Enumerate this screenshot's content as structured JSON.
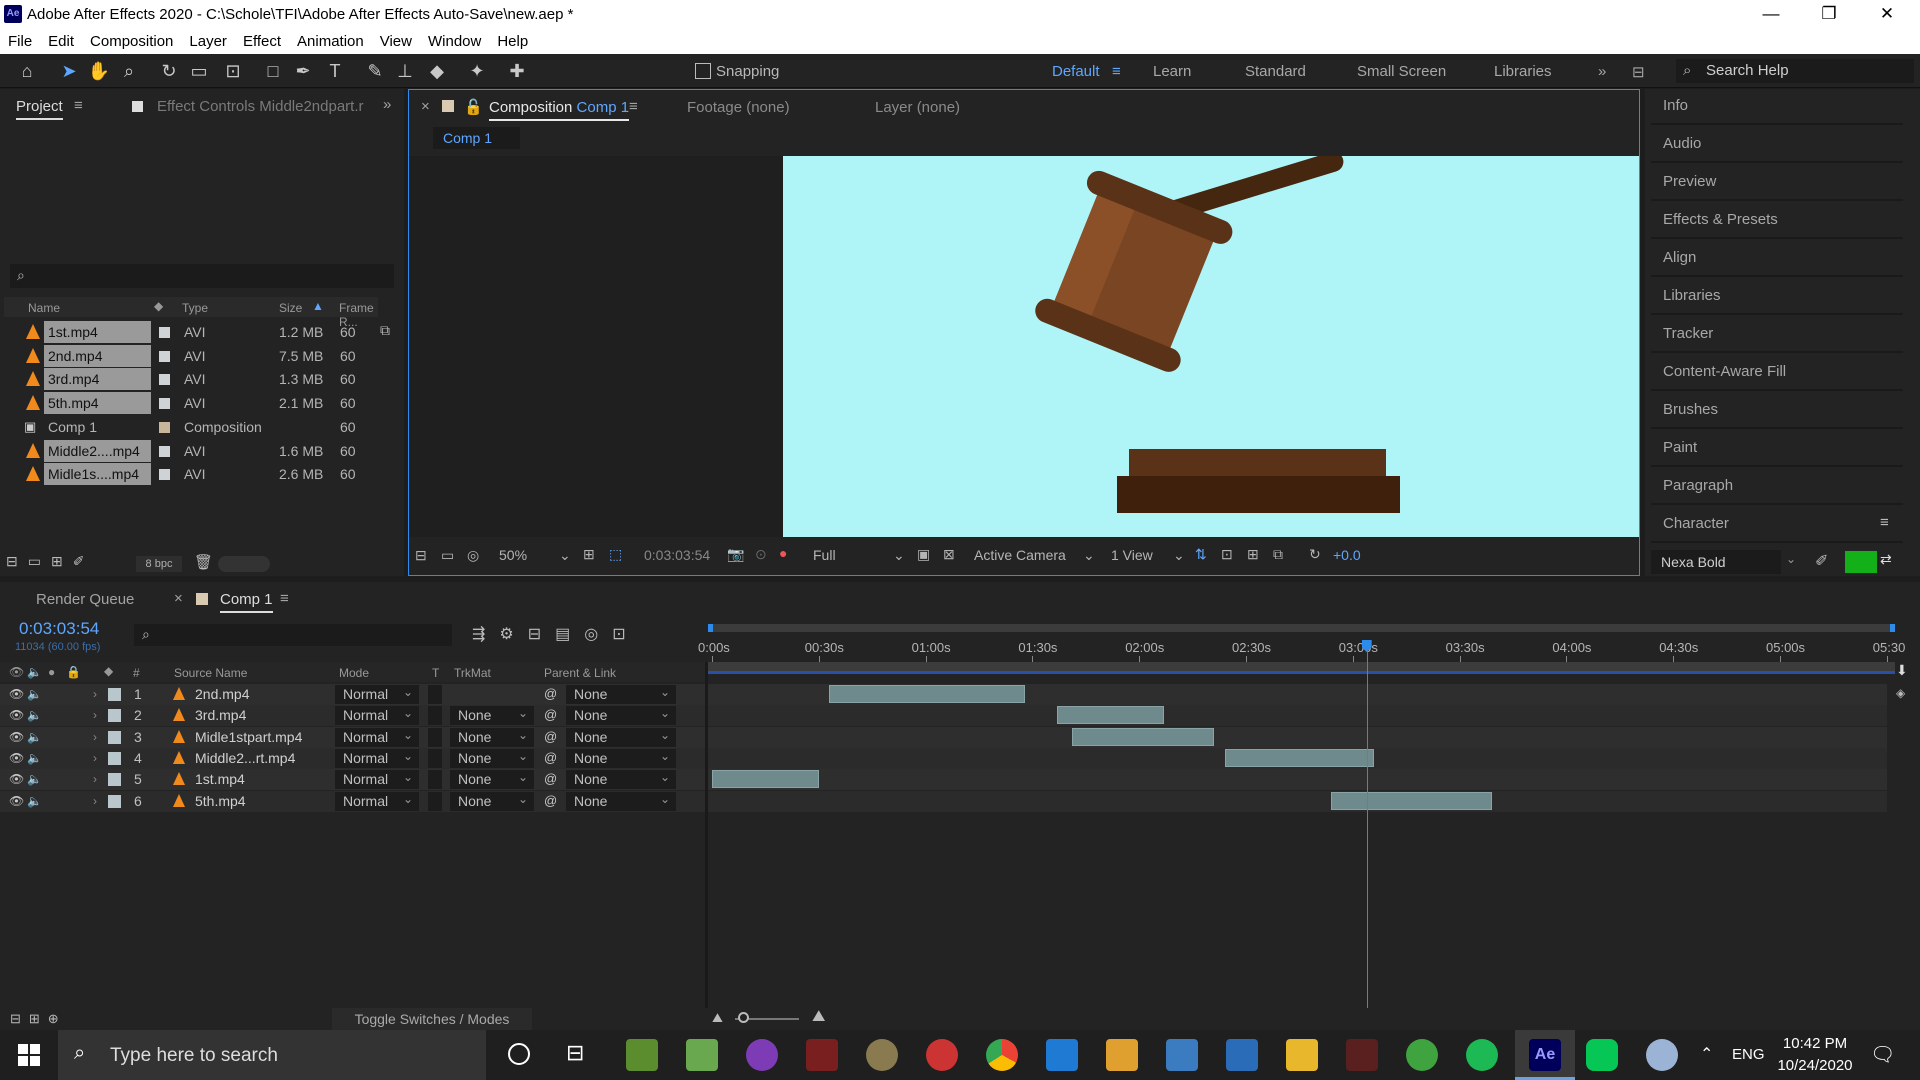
{
  "window": {
    "title": "Adobe After Effects 2020 - C:\\Schole\\TFI\\Adobe After Effects Auto-Save\\new.aep *",
    "logo": "Ae"
  },
  "menu": [
    "File",
    "Edit",
    "Composition",
    "Layer",
    "Effect",
    "Animation",
    "View",
    "Window",
    "Help"
  ],
  "toolbar": {
    "snapping": "Snapping",
    "workspaces": [
      "Default",
      "Learn",
      "Standard",
      "Small Screen",
      "Libraries"
    ],
    "search_help": "Search Help"
  },
  "project": {
    "tab": "Project",
    "effect_tab": "Effect Controls Middle2ndpart.r",
    "columns": {
      "name": "Name",
      "type": "Type",
      "size": "Size",
      "frame": "Frame R..."
    },
    "items": [
      {
        "name": "1st.mp4",
        "type": "AVI",
        "size": "1.2 MB",
        "frame": "60"
      },
      {
        "name": "2nd.mp4",
        "type": "AVI",
        "size": "7.5 MB",
        "frame": "60"
      },
      {
        "name": "3rd.mp4",
        "type": "AVI",
        "size": "1.3 MB",
        "frame": "60"
      },
      {
        "name": "5th.mp4",
        "type": "AVI",
        "size": "2.1 MB",
        "frame": "60"
      },
      {
        "name": "Comp 1",
        "type": "Composition",
        "size": "",
        "frame": "60"
      },
      {
        "name": "Middle2....mp4",
        "type": "AVI",
        "size": "1.6 MB",
        "frame": "60"
      },
      {
        "name": "Midle1s....mp4",
        "type": "AVI",
        "size": "2.6 MB",
        "frame": "60"
      }
    ],
    "bpc": "8 bpc"
  },
  "composition": {
    "tab_label": "Composition",
    "tab_name": "Comp 1",
    "footage": "Footage  (none)",
    "layer": "Layer  (none)",
    "breadcrumb": "Comp 1",
    "zoom": "50%",
    "timecode": "0:03:03:54",
    "resolution": "Full",
    "camera": "Active Camera",
    "views": "1 View",
    "exposure": "+0.0",
    "bg_color": "#aff5f7"
  },
  "right_panels": [
    "Info",
    "Audio",
    "Preview",
    "Effects & Presets",
    "Align",
    "Libraries",
    "Tracker",
    "Content-Aware Fill",
    "Brushes",
    "Paint",
    "Paragraph",
    "Character"
  ],
  "character": {
    "font": "Nexa Bold",
    "fill_color": "#13b01a"
  },
  "timeline": {
    "render_queue": "Render Queue",
    "comp_tab": "Comp 1",
    "timecode": "0:03:03:54",
    "frames": "11034 (60.00 fps)",
    "columns": {
      "source": "Source Name",
      "mode": "Mode",
      "t": "T",
      "trkmat": "TrkMat",
      "parent": "Parent & Link"
    },
    "ruler": [
      "0:00s",
      "00:30s",
      "01:00s",
      "01:30s",
      "02:00s",
      "02:30s",
      "03:00s",
      "03:30s",
      "04:00s",
      "04:30s",
      "05:00s",
      "05:30"
    ],
    "ruler_seconds": [
      0,
      30,
      60,
      90,
      120,
      150,
      180,
      210,
      240,
      270,
      300,
      330
    ],
    "playhead_seconds": 183.9,
    "layers": [
      {
        "num": "1",
        "name": "2nd.mp4",
        "mode": "Normal",
        "trkmat": "",
        "parent": "None",
        "in": 33,
        "out": 88
      },
      {
        "num": "2",
        "name": "3rd.mp4",
        "mode": "Normal",
        "trkmat": "None",
        "parent": "None",
        "in": 97,
        "out": 127
      },
      {
        "num": "3",
        "name": "Midle1stpart.mp4",
        "mode": "Normal",
        "trkmat": "None",
        "parent": "None",
        "in": 101,
        "out": 141
      },
      {
        "num": "4",
        "name": "Middle2...rt.mp4",
        "mode": "Normal",
        "trkmat": "None",
        "parent": "None",
        "in": 144,
        "out": 186
      },
      {
        "num": "5",
        "name": "1st.mp4",
        "mode": "Normal",
        "trkmat": "None",
        "parent": "None",
        "in": 0,
        "out": 30
      },
      {
        "num": "6",
        "name": "5th.mp4",
        "mode": "Normal",
        "trkmat": "None",
        "parent": "None",
        "in": 174,
        "out": 219
      }
    ],
    "toggle": "Toggle Switches / Modes"
  },
  "taskbar": {
    "search": "Type here to search",
    "lang": "ENG",
    "time": "10:42 PM",
    "date": "10/24/2020"
  }
}
